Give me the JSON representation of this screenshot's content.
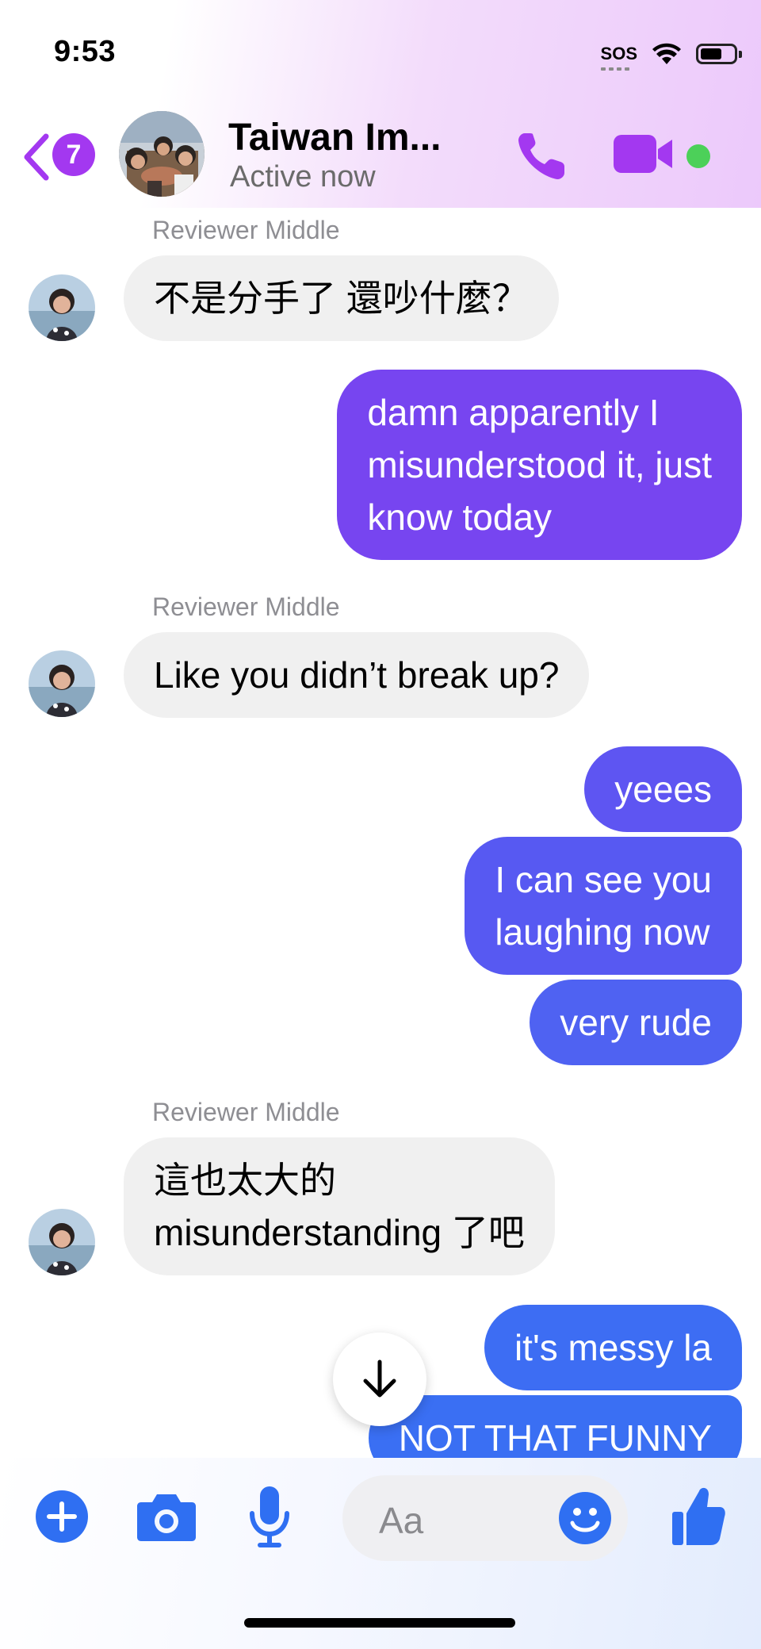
{
  "status_bar": {
    "time": "9:53",
    "sos": "SOS"
  },
  "header": {
    "back_badge": "7",
    "title": "Taiwan Im...",
    "subtitle": "Active now"
  },
  "messages": [
    {
      "sender": "Reviewer Middle",
      "text": "不是分手了 還吵什麼？",
      "direction": "in"
    },
    {
      "lines": [
        "damn apparently I",
        "misunderstood it, just",
        "know today"
      ],
      "direction": "out",
      "color": "#7745f0"
    },
    {
      "sender": "Reviewer Middle",
      "text": "Like you didn’t break up?",
      "direction": "in"
    },
    {
      "text": "yeees",
      "direction": "out",
      "color": "#5e55f2"
    },
    {
      "lines": [
        "I can see you",
        "laughing now"
      ],
      "direction": "out",
      "color": "#5759f2"
    },
    {
      "text": "very rude",
      "direction": "out",
      "color": "#4f62f2"
    },
    {
      "sender": "Reviewer Middle",
      "lines": [
        "這也太大的",
        "misunderstanding 了吧"
      ],
      "direction": "in"
    },
    {
      "text": "it's messy la",
      "direction": "out",
      "color": "#3d6df3"
    },
    {
      "text": "NOT THAT FUNNY",
      "direction": "out",
      "color": "#3a6ff3"
    }
  ],
  "composer": {
    "placeholder": "Aa"
  },
  "colors": {
    "accent": "#a338f0",
    "composer_blue": "#2f6ff2",
    "online": "#4cd059"
  },
  "icons": [
    "chevron-left-icon",
    "phone-icon",
    "video-camera-icon",
    "plus-icon",
    "camera-icon",
    "microphone-icon",
    "emoji-icon",
    "thumbs-up-icon",
    "arrow-down-icon"
  ]
}
